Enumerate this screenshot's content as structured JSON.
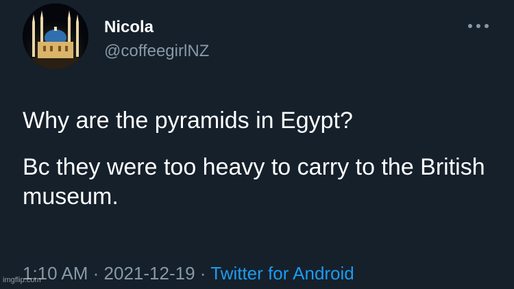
{
  "tweet": {
    "display_name": "Nicola",
    "handle": "@coffeegirlNZ",
    "text_lines": [
      "Why are the pyramids in Egypt?",
      "Bc they were too heavy to carry to the British museum."
    ],
    "time": "1:10 AM",
    "separator": "·",
    "date": "2021-12-19",
    "source": "Twitter for Android"
  },
  "icons": {
    "avatar": "mosque-at-night-avatar",
    "more": "more-horizontal-icon"
  },
  "colors": {
    "background": "#15202b",
    "text_primary": "#ffffff",
    "text_secondary": "#8899a6",
    "link": "#1d9bf0"
  },
  "watermark": "imgflip.com"
}
